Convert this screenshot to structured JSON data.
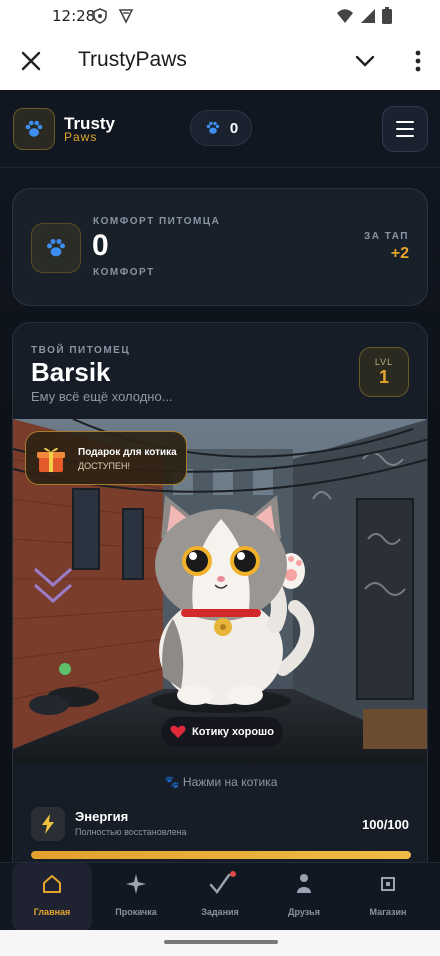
{
  "status_bar": {
    "time": "12:28"
  },
  "webview": {
    "title": "TrustyPaws"
  },
  "header": {
    "brand_line1": "Trusty",
    "brand_line2": "Paws",
    "paw_count": "0",
    "accent_color": "#e5a630"
  },
  "comfort": {
    "label": "КОМФОРТ ПИТОМЦА",
    "value": "0",
    "sub_label": "КОМФОРТ",
    "tap_label": "ЗА ТАП",
    "tap_value": "+2"
  },
  "pet": {
    "caption": "ТВОЙ ПИТОМЕЦ",
    "name": "Barsik",
    "mood": "Ему всё ещё холодно...",
    "level_label": "LVL",
    "level": "1",
    "gift_title": "Подарок для котика",
    "gift_status": "ДОСТУПЕН!",
    "state_pill": "Котику хорошо",
    "tap_hint": "🐾 Нажми на котика"
  },
  "energy": {
    "title": "Энергия",
    "subtitle": "Полностью восстановлена",
    "value_text": "100/100",
    "fraction": 1.0
  },
  "bottom_nav": {
    "items": [
      {
        "label": "Главная",
        "icon": "home-icon"
      },
      {
        "label": "Прокачка",
        "icon": "sparkle-icon"
      },
      {
        "label": "Задания",
        "icon": "check-icon"
      },
      {
        "label": "Друзья",
        "icon": "person-icon"
      },
      {
        "label": "Магазин",
        "icon": "shop-icon"
      }
    ],
    "active": 0
  }
}
